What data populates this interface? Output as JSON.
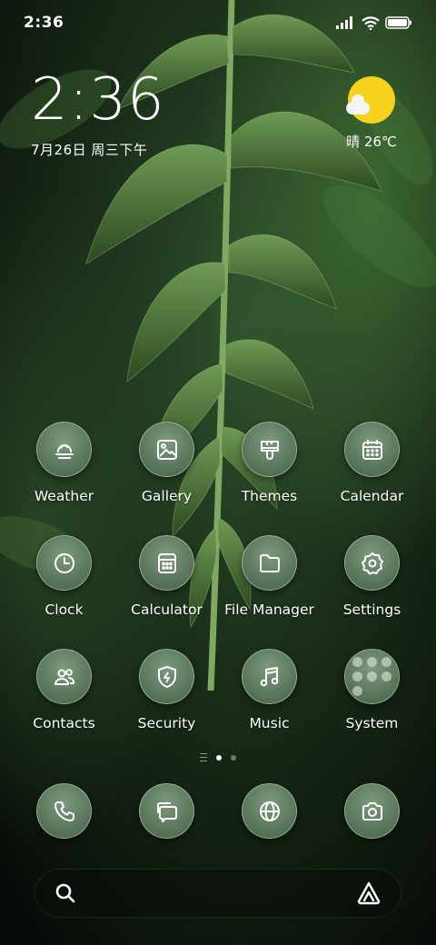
{
  "status_bar": {
    "time": "2:36",
    "icons": [
      "signal-icon",
      "wifi-icon",
      "battery-icon"
    ]
  },
  "clock_widget": {
    "time": "2:36",
    "date": "7月26日 周三下午"
  },
  "weather_widget": {
    "icon": "sunny-cloud-icon",
    "text": "晴 26℃"
  },
  "apps": [
    [
      {
        "label": "Weather",
        "icon": "weather-icon"
      },
      {
        "label": "Gallery",
        "icon": "gallery-icon"
      },
      {
        "label": "Themes",
        "icon": "themes-icon"
      },
      {
        "label": "Calendar",
        "icon": "calendar-icon"
      }
    ],
    [
      {
        "label": "Clock",
        "icon": "clock-icon"
      },
      {
        "label": "Calculator",
        "icon": "calculator-icon"
      },
      {
        "label": "File Manager",
        "icon": "folder-icon"
      },
      {
        "label": "Settings",
        "icon": "gear-icon"
      }
    ],
    [
      {
        "label": "Contacts",
        "icon": "contacts-icon"
      },
      {
        "label": "Security",
        "icon": "shield-icon"
      },
      {
        "label": "Music",
        "icon": "music-icon"
      },
      {
        "label": "System",
        "icon": "folder-grid-icon"
      }
    ]
  ],
  "page_indicator": {
    "pages": 2,
    "active": 1
  },
  "dock": [
    {
      "icon": "phone-icon"
    },
    {
      "icon": "messages-icon"
    },
    {
      "icon": "browser-icon"
    },
    {
      "icon": "camera-icon"
    }
  ],
  "search_bar": {
    "left_icon": "search-icon",
    "right_icon": "assistant-icon"
  },
  "colors": {
    "accent_sun": "#f7d21c",
    "icon_fill": "#5d7a5e"
  }
}
